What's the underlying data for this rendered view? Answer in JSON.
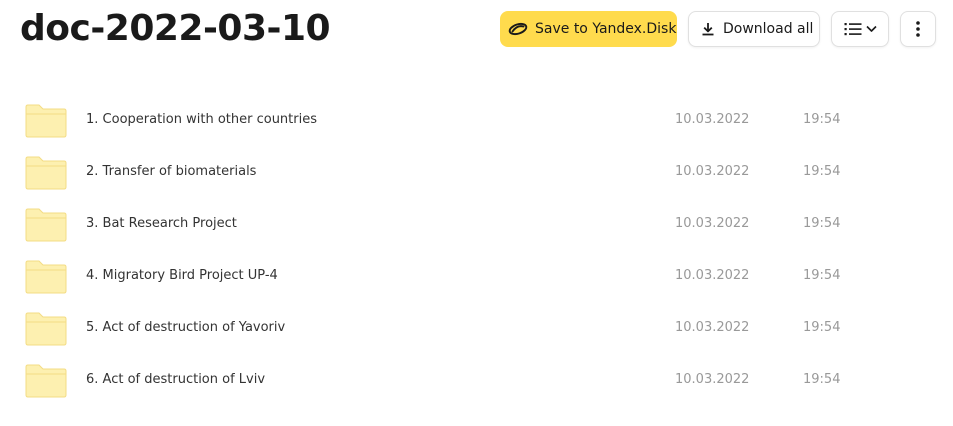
{
  "header": {
    "title": "doc-2022-03-10",
    "save_label": "Save to Yandex.Disk",
    "download_label": "Download all"
  },
  "colors": {
    "save_button": "#ffdb4d",
    "folder_fill": "#fdf0b0",
    "folder_stroke": "#f3dc85",
    "date_text": "#999999"
  },
  "icons": {
    "save": "yandex-disk-icon",
    "download": "download-icon",
    "view": "list-view-icon",
    "dropdown": "chevron-down-icon",
    "more": "more-vertical-icon",
    "folder": "folder-icon"
  },
  "files": [
    {
      "name": "1. Cooperation with other countries",
      "date": "10.03.2022",
      "time": "19:54"
    },
    {
      "name": "2. Transfer of biomaterials",
      "date": "10.03.2022",
      "time": "19:54"
    },
    {
      "name": "3. Bat Research Project",
      "date": "10.03.2022",
      "time": "19:54"
    },
    {
      "name": "4. Migratory Bird Project UP-4",
      "date": "10.03.2022",
      "time": "19:54"
    },
    {
      "name": "5. Act of destruction of Yavoriv",
      "date": "10.03.2022",
      "time": "19:54"
    },
    {
      "name": "6. Act of destruction of Lviv",
      "date": "10.03.2022",
      "time": "19:54"
    }
  ]
}
